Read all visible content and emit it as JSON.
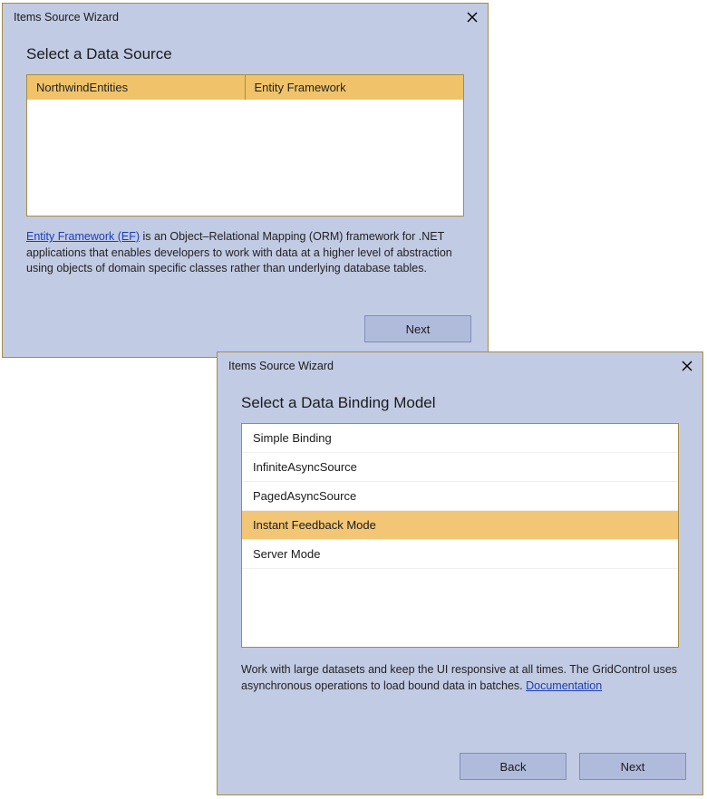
{
  "dialog1": {
    "title": "Items Source Wizard",
    "heading": "Select a Data Source",
    "table": {
      "headers": [
        "NorthwindEntities",
        "Entity Framework"
      ]
    },
    "desc_link_text": "Entity Framework (EF)",
    "desc_rest": " is an Object–Relational Mapping (ORM) framework for .NET applications that enables developers to work with data at a higher level of abstraction using objects of domain specific classes rather than underlying database tables.",
    "next_label": "Next"
  },
  "dialog2": {
    "title": "Items Source Wizard",
    "heading": "Select a Data Binding Model",
    "items": [
      "Simple Binding",
      "InfiniteAsyncSource",
      "PagedAsyncSource",
      "Instant Feedback Mode",
      "Server Mode"
    ],
    "selected_index": 3,
    "desc_text": "Work with large datasets and keep the UI responsive at all times. The GridControl uses asynchronous operations to load bound data in batches. ",
    "desc_link_text": "Documentation",
    "back_label": "Back",
    "next_label": "Next"
  }
}
